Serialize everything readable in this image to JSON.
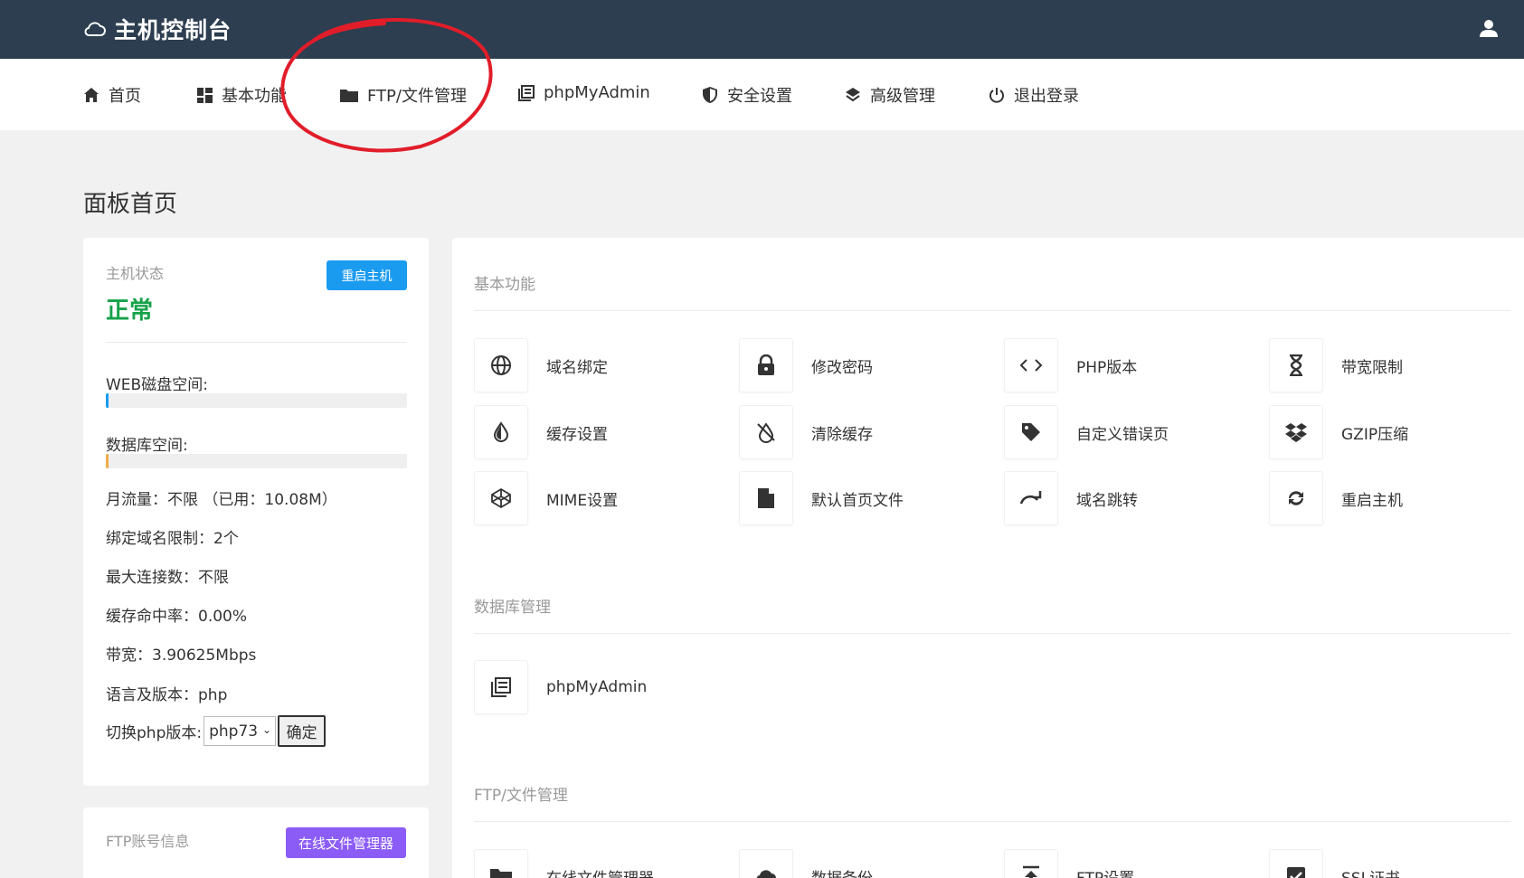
{
  "header": {
    "title": "主机控制台",
    "icons": {
      "brand": "cloud-icon",
      "user": "user-icon"
    }
  },
  "nav": [
    {
      "label": "首页",
      "icon": "home-icon"
    },
    {
      "label": "基本功能",
      "icon": "grid-icon"
    },
    {
      "label": "FTP/文件管理",
      "icon": "folder-icon"
    },
    {
      "label": "phpMyAdmin",
      "icon": "database-icon"
    },
    {
      "label": "安全设置",
      "icon": "shield-icon"
    },
    {
      "label": "高级管理",
      "icon": "layers-icon"
    },
    {
      "label": "退出登录",
      "icon": "power-icon"
    }
  ],
  "page": {
    "title": "面板首页"
  },
  "host": {
    "status_label": "主机状态",
    "status_value": "正常",
    "restart_label": "重启主机",
    "web_disk_label": "WEB磁盘空间:",
    "web_disk_usage": 0.01,
    "db_space_label": "数据库空间:",
    "db_space_usage": 0.01,
    "traffic": "月流量：不限 （已用：10.08M）",
    "domain_limit": "绑定域名限制：2个",
    "max_conn": "最大连接数：不限",
    "cache_hit": "缓存命中率：0.00%",
    "bandwidth": "带宽：3.90625Mbps",
    "language": "语言及版本：php",
    "php_switch_label": "切换php版本:",
    "php_version": "php73",
    "php_ok": "确定"
  },
  "ftp_card": {
    "label": "FTP账号信息",
    "button": "在线文件管理器"
  },
  "sections": {
    "basic": {
      "title": "基本功能",
      "items": [
        {
          "label": "域名绑定",
          "icon": "globe-icon"
        },
        {
          "label": "修改密码",
          "icon": "lock-icon"
        },
        {
          "label": "PHP版本",
          "icon": "code-icon"
        },
        {
          "label": "带宽限制",
          "icon": "hourglass-icon"
        },
        {
          "label": "缓存设置",
          "icon": "drop-icon"
        },
        {
          "label": "清除缓存",
          "icon": "no-drop-icon"
        },
        {
          "label": "自定义错误页",
          "icon": "tag-icon"
        },
        {
          "label": "GZIP压缩",
          "icon": "dropbox-icon"
        },
        {
          "label": "MIME设置",
          "icon": "codepen-icon"
        },
        {
          "label": "默认首页文件",
          "icon": "file-icon"
        },
        {
          "label": "域名跳转",
          "icon": "redirect-icon"
        },
        {
          "label": "重启主机",
          "icon": "refresh-icon"
        }
      ]
    },
    "database": {
      "title": "数据库管理",
      "items": [
        {
          "label": "phpMyAdmin",
          "icon": "database-icon"
        }
      ]
    },
    "ftp": {
      "title": "FTP/文件管理",
      "items": [
        {
          "label": "在线文件管理器",
          "icon": "folder-icon"
        },
        {
          "label": "数据备份",
          "icon": "cloud-icon"
        },
        {
          "label": "FTP设置",
          "icon": "upload-icon"
        },
        {
          "label": "SSL证书",
          "icon": "check-square-icon"
        }
      ]
    }
  },
  "colors": {
    "header_bg": "#2c3e50",
    "accent_blue": "#1a9bf0",
    "accent_purple": "#8b5cf6",
    "status_green": "#16a34a",
    "bar_web": "#1a9bf0",
    "bar_db": "#f0ad4e",
    "annotation": "#e11d2a"
  }
}
